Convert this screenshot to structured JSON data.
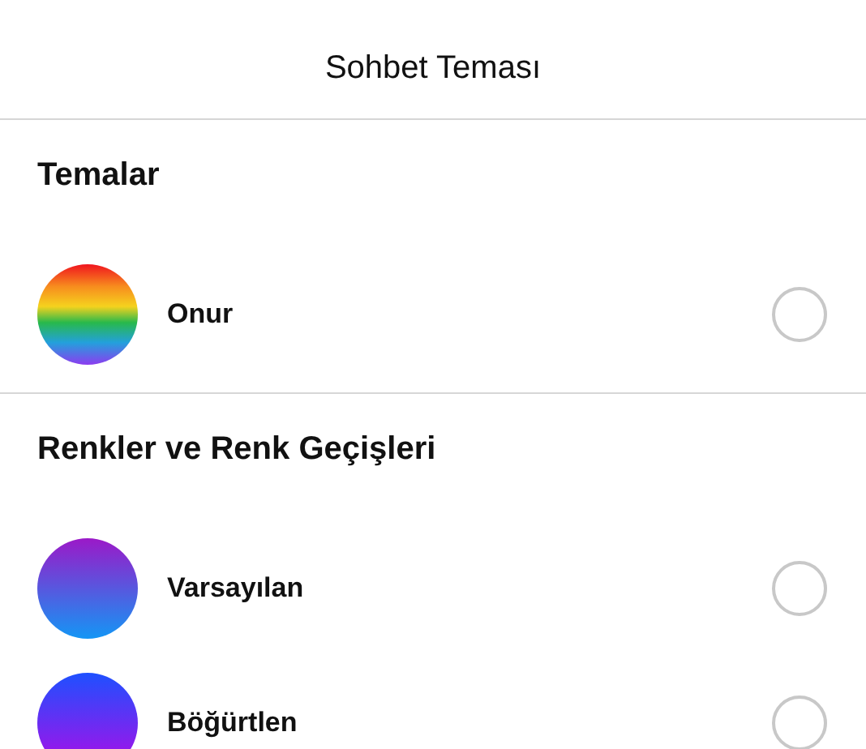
{
  "header": {
    "title": "Sohbet Teması"
  },
  "sections": [
    {
      "title": "Temalar",
      "items": [
        {
          "label": "Onur",
          "kind": "rainbow",
          "selected": false
        }
      ]
    },
    {
      "title": "Renkler ve Renk Geçişleri",
      "items": [
        {
          "label": "Varsayılan",
          "kind": "blueward",
          "color": "#9b19c8",
          "selected": false
        },
        {
          "label": "Böğürtlen",
          "kind": "violetward",
          "color": "#1e50ff",
          "selected": false
        }
      ]
    }
  ]
}
